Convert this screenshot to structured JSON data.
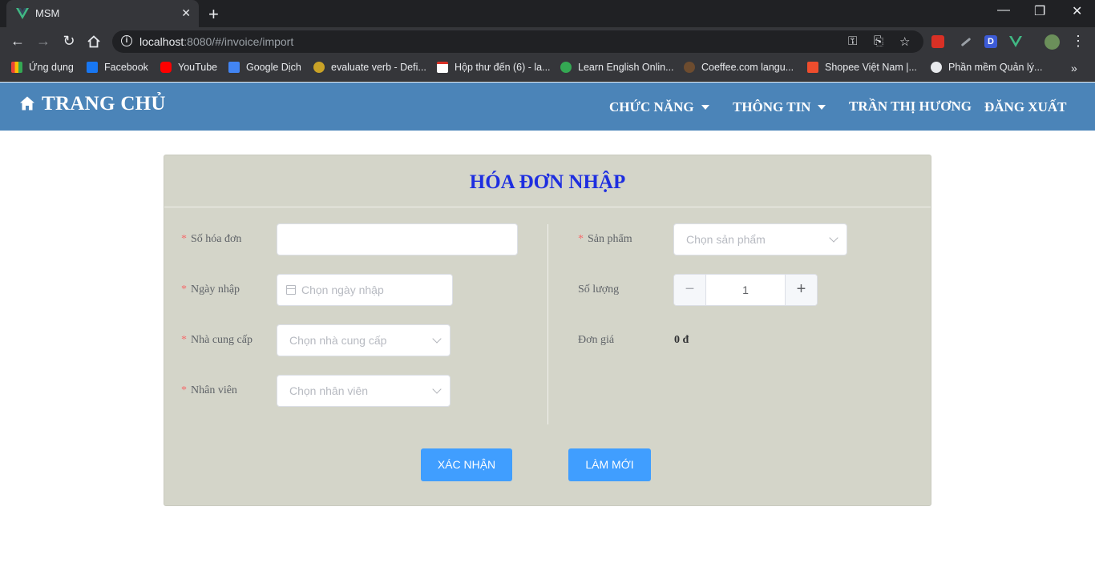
{
  "browser": {
    "tab_title": "MSM",
    "url_host": "localhost",
    "url_rest": ":8080/#/invoice/import",
    "bookmarks": [
      {
        "label": "Ứng dụng",
        "icon": "apps-grid-icon"
      },
      {
        "label": "Facebook",
        "icon": "facebook-icon"
      },
      {
        "label": "YouTube",
        "icon": "youtube-icon"
      },
      {
        "label": "Google Dịch",
        "icon": "google-translate-icon"
      },
      {
        "label": "evaluate verb - Defi...",
        "icon": "dictionary-icon"
      },
      {
        "label": "Hộp thư đến (6) - la...",
        "icon": "gmail-icon"
      },
      {
        "label": "Learn English Onlin...",
        "icon": "learn-english-icon"
      },
      {
        "label": "Coeffee.com langu...",
        "icon": "coeffee-icon"
      },
      {
        "label": "Shopee Việt Nam |...",
        "icon": "shopee-icon"
      },
      {
        "label": "Phần mềm Quản lý...",
        "icon": "globe-icon"
      }
    ]
  },
  "header": {
    "brand": "TRANG CHỦ",
    "nav": {
      "features": "CHỨC NĂNG",
      "info": "THÔNG TIN",
      "user": "TRẦN THỊ HƯƠNG",
      "logout": "ĐĂNG XUẤT"
    }
  },
  "form": {
    "title": "HÓA ĐƠN NHẬP",
    "required_mark": "*",
    "invoice_no": {
      "label": "Số hóa đơn",
      "value": ""
    },
    "import_date": {
      "label": "Ngày nhập",
      "placeholder": "Chọn ngày nhập"
    },
    "supplier": {
      "label": "Nhà cung cấp",
      "placeholder": "Chọn nhà cung cấp"
    },
    "employee": {
      "label": "Nhân viên",
      "placeholder": "Chọn nhân viên"
    },
    "product": {
      "label": "Sản phẩm",
      "placeholder": "Chọn sản phẩm"
    },
    "quantity": {
      "label": "Số lượng",
      "value": "1",
      "minus": "−",
      "plus": "+"
    },
    "unit_price": {
      "label": "Đơn giá",
      "value": "0 đ"
    },
    "confirm_button": "XÁC NHẬN",
    "reset_button": "LÀM MỚI"
  },
  "colors": {
    "header_bg": "#4b84b8",
    "card_bg": "#d4d5c9",
    "title": "#1e2ee0",
    "primary_button": "#409eff",
    "required": "#f56c6c"
  }
}
